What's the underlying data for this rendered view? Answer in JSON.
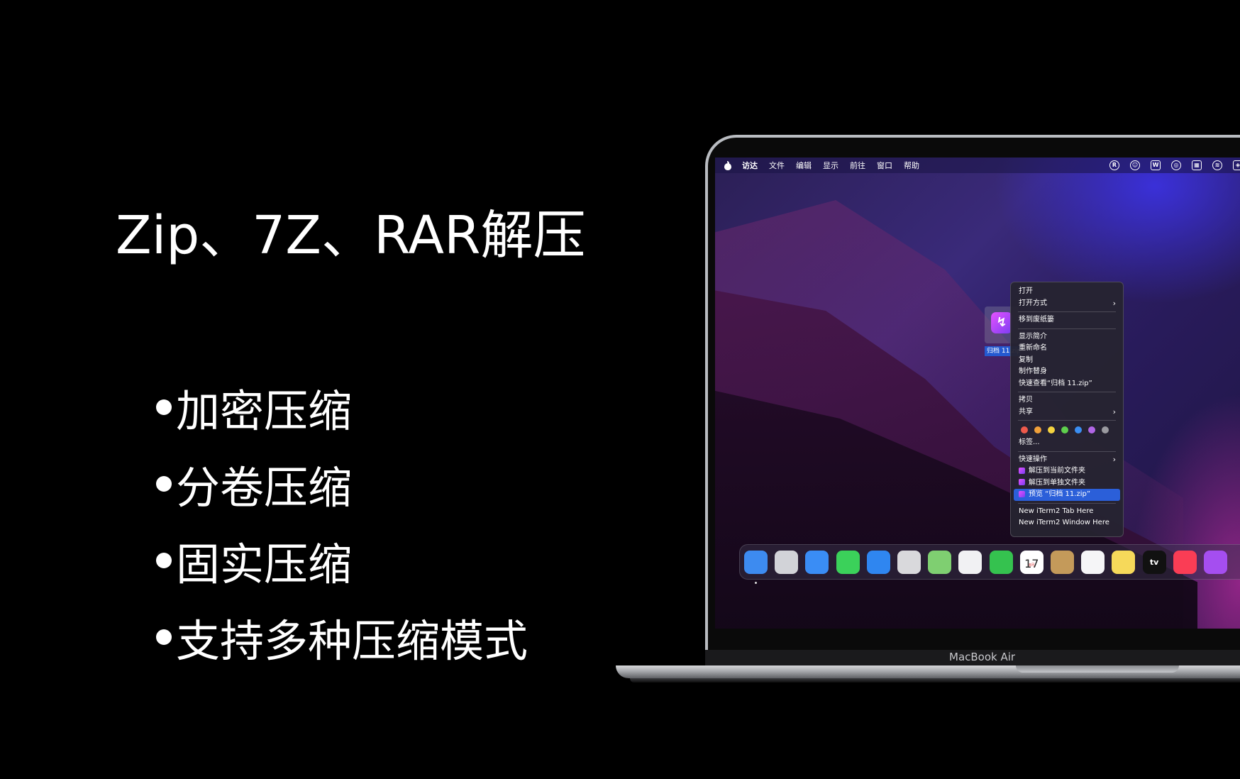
{
  "headline": "Zip、7Z、RAR解压",
  "features": [
    "加密压缩",
    "分卷压缩",
    "固实压缩",
    "支持多种压缩模式"
  ],
  "menubar": {
    "apple": "apple-icon",
    "items": [
      "访达",
      "文件",
      "编辑",
      "显示",
      "前往",
      "窗口",
      "帮助"
    ],
    "status_icons": [
      "R",
      "☺",
      "W",
      "◎",
      "▦",
      "≋",
      "◈"
    ]
  },
  "file": {
    "label": "归档 11.zip",
    "icon": "archive-app-icon"
  },
  "context_menu": {
    "group1": [
      "打开",
      "打开方式"
    ],
    "group2": [
      "移到废纸篓"
    ],
    "group3": [
      "显示简介",
      "重新命名",
      "复制",
      "制作替身",
      "快速查看“归档 11.zip”"
    ],
    "group4": [
      "拷贝",
      "共享"
    ],
    "tag_colors": [
      "#ee5a4c",
      "#f0a03a",
      "#f5d340",
      "#5fcf4d",
      "#3b8ef2",
      "#b166e6",
      "#9a9aa0"
    ],
    "tags_label": "标签...",
    "quick_actions_label": "快速操作",
    "quick_actions": [
      "解压到当前文件夹",
      "解压到单独文件夹",
      "预览 “归档 11.zip”"
    ],
    "iterm_items": [
      "New iTerm2 Tab Here",
      "New iTerm2 Window Here"
    ]
  },
  "dock": {
    "apps": [
      {
        "name": "finder",
        "color": "#3d8bf0"
      },
      {
        "name": "launchpad",
        "color": "#d2d3d8"
      },
      {
        "name": "safari",
        "color": "#3a8df5"
      },
      {
        "name": "messages",
        "color": "#3bd15a"
      },
      {
        "name": "mail",
        "color": "#2f86f0"
      },
      {
        "name": "screenshot",
        "color": "#d9d9dc"
      },
      {
        "name": "maps",
        "color": "#7fcf71"
      },
      {
        "name": "photos",
        "color": "#f1f1f3"
      },
      {
        "name": "facetime",
        "color": "#35c24f"
      },
      {
        "name": "calendar",
        "color": "#ffffff"
      },
      {
        "name": "contacts",
        "color": "#c49a5a"
      },
      {
        "name": "reminders",
        "color": "#f5f5f7"
      },
      {
        "name": "notes",
        "color": "#f6d95a"
      },
      {
        "name": "apple-tv",
        "color": "#111111"
      },
      {
        "name": "music",
        "color": "#fa3d55"
      },
      {
        "name": "podcasts",
        "color": "#a54ef0"
      }
    ],
    "calendar_month": "8月",
    "calendar_day": "17",
    "tv_label": "tv"
  },
  "laptop": {
    "model": "MacBook Air"
  }
}
